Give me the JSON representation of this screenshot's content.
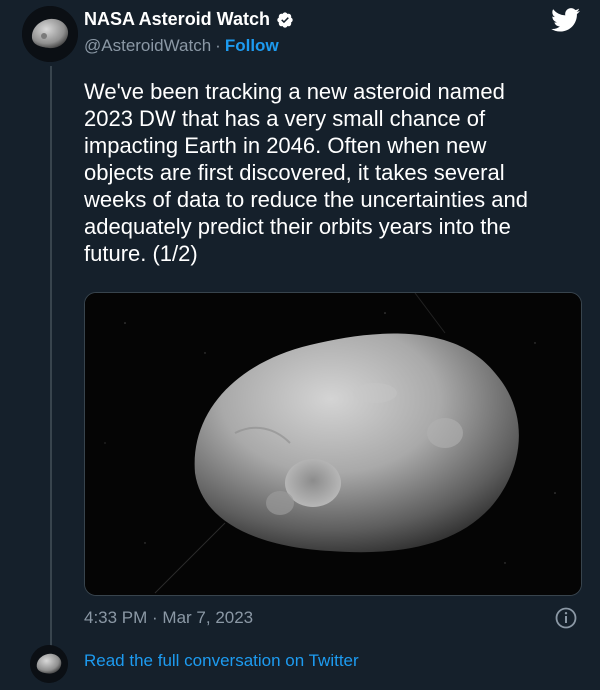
{
  "tweet": {
    "display_name": "NASA Asteroid Watch",
    "handle": "@AsteroidWatch",
    "separator": "·",
    "follow_label": "Follow",
    "text": "We've been tracking a new asteroid named\n2023 DW that has a very small chance of\nimpacting Earth in 2046. Often when new\nobjects are first discovered, it takes several\nweeks of data to reduce the uncertainties and\nadequately predict their orbits years into the\nfuture. (1/2)",
    "timestamp": "4:33 PM · Mar 7, 2023",
    "read_more_label": "Read the full conversation on Twitter"
  },
  "icons": {
    "verified": "verified-badge-icon",
    "brand": "twitter-bird-icon",
    "info": "info-icon"
  },
  "colors": {
    "background": "#15202b",
    "link": "#1d9bf0",
    "secondary_text": "#8b98a5",
    "border": "#38444d"
  }
}
